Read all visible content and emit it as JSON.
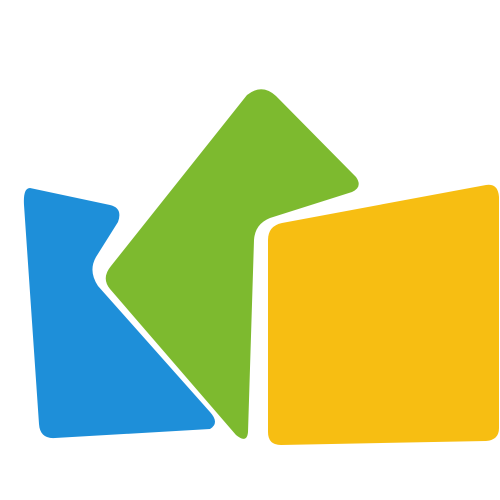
{
  "logo": {
    "icon_name": "crown-shapes-logo",
    "colors": {
      "background": "#ffffff",
      "blue": "#1E8FD9",
      "green": "#7DBA2F",
      "yellow": "#F7BE12"
    }
  }
}
